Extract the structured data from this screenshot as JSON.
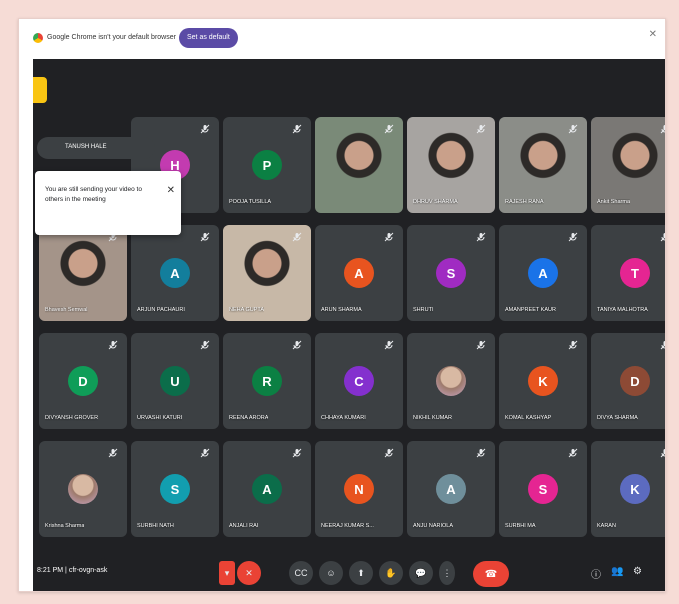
{
  "browser": {
    "info_text": "Google Chrome isn't your default browser",
    "set_default_label": "Set as default",
    "close_glyph": "✕"
  },
  "meeting": {
    "time": "8:21 PM",
    "separator": "|",
    "code": "cfr-ovgn-ask",
    "presenting_label": "TANUSH HALE",
    "popup_text": "You are still sending your video to others in the meeting",
    "popup_close": "✕"
  },
  "colors": {
    "accent": "#5b4ba6",
    "meet_bg": "#202124",
    "tile_bg": "#3c4043",
    "end_call": "#ea4335"
  },
  "participants": [
    {
      "name": "",
      "initial": "H",
      "color": "#c33bb0",
      "video": false
    },
    {
      "name": "POOJA TUSILLA",
      "initial": "P",
      "color": "#0b8043",
      "video": false
    },
    {
      "name": "",
      "initial": "",
      "color": "#7a8a78",
      "video": true
    },
    {
      "name": "DHRUV SHARMA",
      "initial": "",
      "color": "#a7a4a1",
      "video": true
    },
    {
      "name": "RAJESH RANA",
      "initial": "",
      "color": "#8b8d88",
      "video": true
    },
    {
      "name": "Ankit Sharma",
      "initial": "",
      "color": "#7a7875",
      "video": true
    },
    {
      "name": "Bhavesh Semwal",
      "initial": "",
      "color": "#a49489",
      "video": true
    },
    {
      "name": "ARJUN PACHAURI",
      "initial": "A",
      "color": "#137e9c",
      "video": false
    },
    {
      "name": "NEHA GUPTA",
      "initial": "",
      "color": "#c7b8a7",
      "video": true
    },
    {
      "name": "ARUN SHARMA",
      "initial": "A",
      "color": "#e8541f",
      "video": false
    },
    {
      "name": "SHRUTI",
      "initial": "S",
      "color": "#a02bc2",
      "video": false
    },
    {
      "name": "AMANPREET KAUR",
      "initial": "A",
      "color": "#1a73e8",
      "video": false
    },
    {
      "name": "TANIYA MALHOTRA",
      "initial": "T",
      "color": "#e52592",
      "video": false
    },
    {
      "name": "DIVYANSH GROVER",
      "initial": "D",
      "color": "#0f9d58",
      "video": false
    },
    {
      "name": "URVASHI KATURI",
      "initial": "U",
      "color": "#0b6d4a",
      "video": false
    },
    {
      "name": "REENA ARORA",
      "initial": "R",
      "color": "#0b8043",
      "video": false
    },
    {
      "name": "CHHAYA KUMARI",
      "initial": "C",
      "color": "#8430ce",
      "video": false
    },
    {
      "name": "NIKHIL KUMAR",
      "initial": "",
      "color": "#c7a9c3",
      "video": false,
      "photo": true
    },
    {
      "name": "KOMAL KASHYAP",
      "initial": "K",
      "color": "#e8541f",
      "video": false
    },
    {
      "name": "DIVYA SHARMA",
      "initial": "D",
      "color": "#8d4a35",
      "video": false
    },
    {
      "name": "Krishna Sharma",
      "initial": "",
      "color": "#5f6368",
      "video": false,
      "photo": true
    },
    {
      "name": "SURBHI NATH",
      "initial": "S",
      "color": "#129eaf",
      "video": false
    },
    {
      "name": "ANJALI RAI",
      "initial": "A",
      "color": "#0b6d4a",
      "video": false
    },
    {
      "name": "NEERAJ KUMAR S...",
      "initial": "N",
      "color": "#e8541f",
      "video": false
    },
    {
      "name": "ANJU NARIOLA",
      "initial": "A",
      "color": "#6f8f9b",
      "video": false
    },
    {
      "name": "SURBHI MA",
      "initial": "S",
      "color": "#e52592",
      "video": false
    },
    {
      "name": "KARAN",
      "initial": "K",
      "color": "#5c6bc0",
      "video": false
    }
  ],
  "controls": {
    "more": "▾",
    "mic": "🎙",
    "cc": "CC",
    "emoji": "☺",
    "present": "⬆",
    "raise_hand": "✋",
    "options": "⋮",
    "end_call": "☎",
    "info": "ⓘ",
    "people": "👥",
    "chat": "💬",
    "activities": "⚙",
    "mic_off": "✕"
  }
}
